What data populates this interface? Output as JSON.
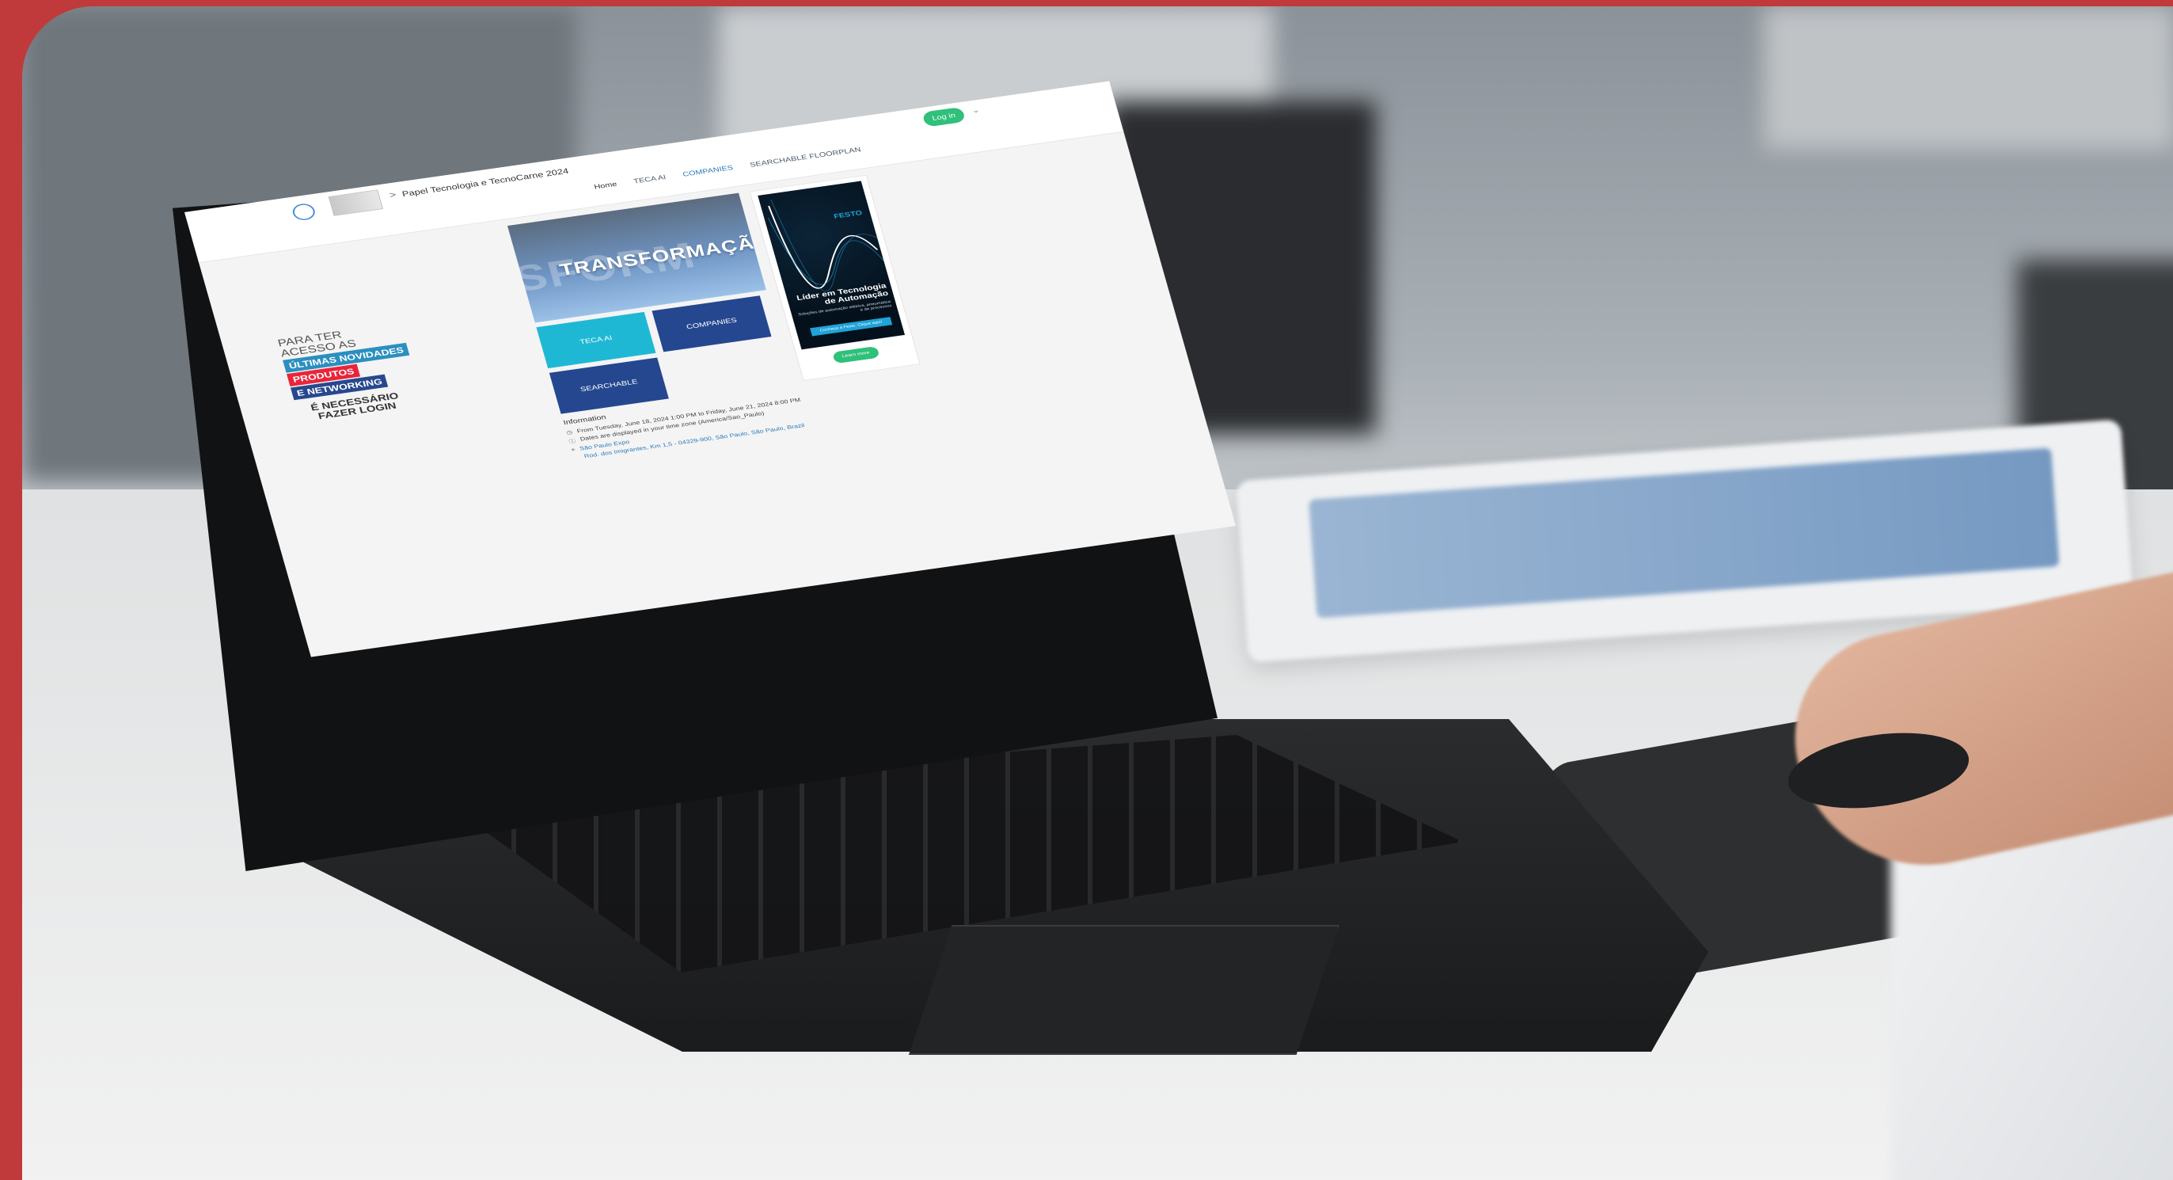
{
  "header": {
    "event_title": "Papel Tecnologia e TecnoCarne 2024",
    "crumb_sep": ">",
    "login_label": "Log in",
    "lang_chevron": "⌄"
  },
  "nav": {
    "items": [
      "Home",
      "TECA AI",
      "COMPANIES",
      "SEARCHABLE FLOORPLAN"
    ]
  },
  "promo": {
    "intro_line1": "PARA TER",
    "intro_line2": "ACESSO AS",
    "pill1": "ÚLTIMAS NOVIDADES",
    "pill2": "PRODUTOS",
    "pill3": "E NETWORKING",
    "footer_line1": "É NECESSÁRIO",
    "footer_line2": "FAZER LOGIN"
  },
  "hero": {
    "ghost_text": "SFORM",
    "headline": "TRANSFORMAÇÃO"
  },
  "tiles": {
    "teca": "TECA AI",
    "companies": "COMPANIES",
    "floorplan": "SEARCHABLE FLOORPLAN"
  },
  "info": {
    "title": "Information",
    "dates": "From Tuesday, June 18, 2024 1:00 PM to Friday, June 21, 2024 8:00 PM",
    "timezone": "Dates are displayed in your time zone (America/Sao_Paulo)",
    "venue": "São Paulo Expo",
    "address": "Rod. dos Imigrantes, Km 1,5 - 04329-900, São Paulo, São Paulo, Brazil"
  },
  "ad": {
    "brand": "FESTO",
    "headline_line1": "Líder em Tecnologia",
    "headline_line2": "de Automação",
    "subtext": "Soluções de automação elétrica, pneumática e de processos",
    "cta": "Conheça a Festo. Clique aqui!",
    "learn_more": "Learn more"
  },
  "colors": {
    "frame_red": "#c0393b",
    "login_green": "#2fc07a",
    "tile_teal": "#1fb8d4",
    "tile_navy": "#24478f",
    "pill_red": "#e8253b"
  }
}
